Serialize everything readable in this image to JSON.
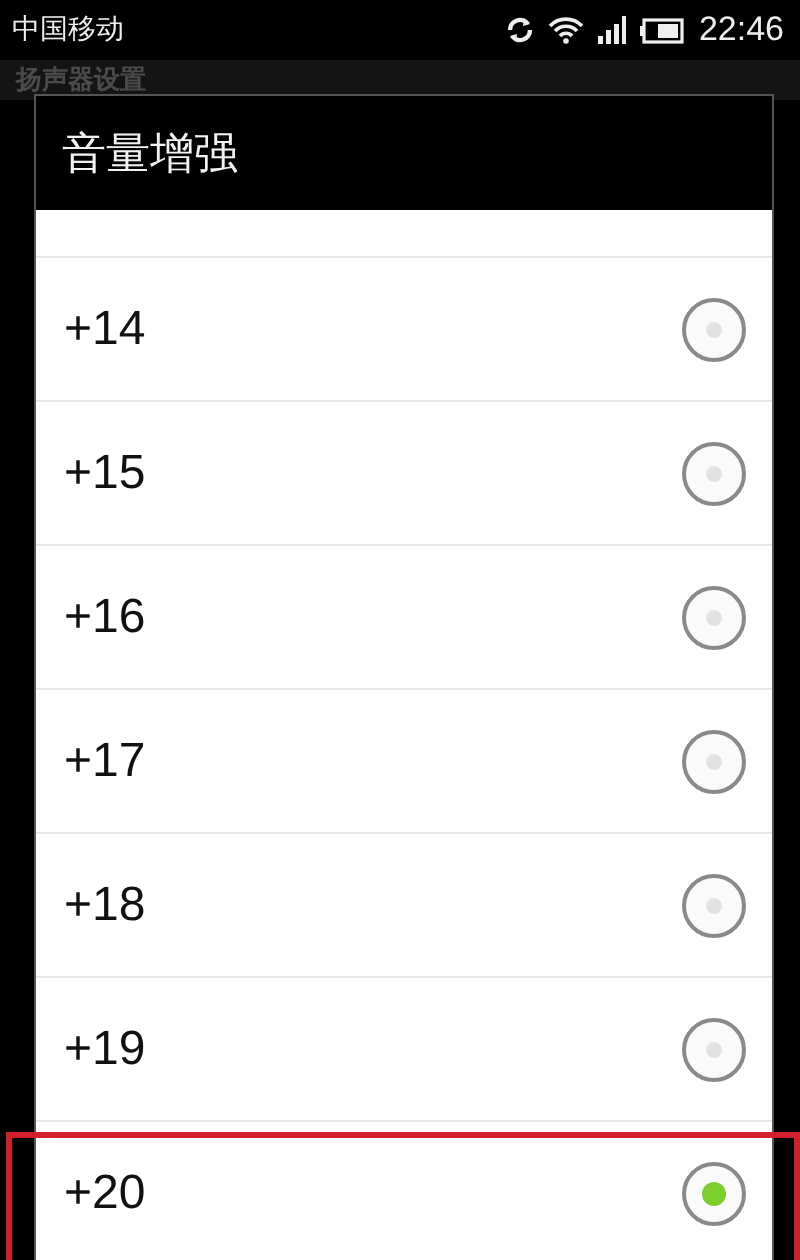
{
  "status_bar": {
    "carrier": "中国移动",
    "time": "22:46"
  },
  "background_page": {
    "title": "扬声器设置"
  },
  "dialog": {
    "title": "音量增强",
    "options": [
      {
        "label": "+14",
        "selected": false,
        "highlighted": false
      },
      {
        "label": "+15",
        "selected": false,
        "highlighted": false
      },
      {
        "label": "+16",
        "selected": false,
        "highlighted": false
      },
      {
        "label": "+17",
        "selected": false,
        "highlighted": false
      },
      {
        "label": "+18",
        "selected": false,
        "highlighted": false
      },
      {
        "label": "+19",
        "selected": false,
        "highlighted": false
      },
      {
        "label": "+20",
        "selected": true,
        "highlighted": true
      }
    ]
  }
}
